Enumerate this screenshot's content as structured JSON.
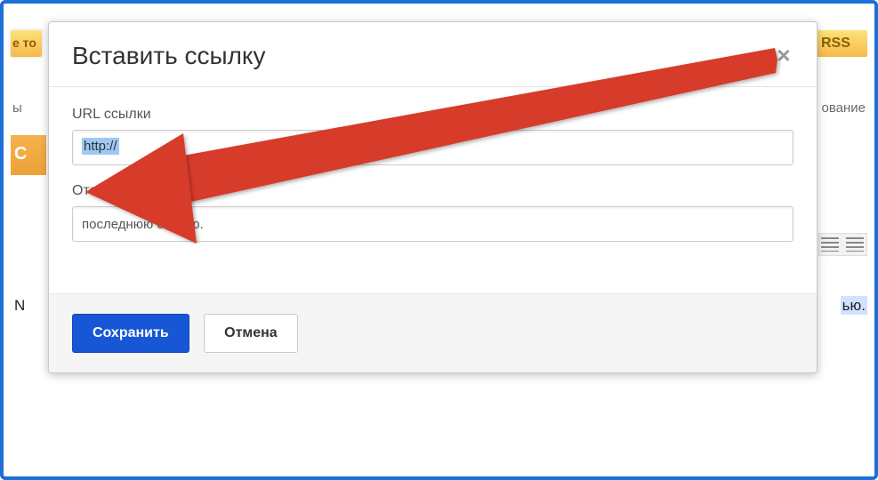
{
  "modal": {
    "title": "Вставить ссылку",
    "url_label": "URL ссылки",
    "url_value": "http://",
    "text_label": "Отображаемый текст",
    "text_value": "последнюю статью.",
    "save_label": "Сохранить",
    "cancel_label": "Отмена"
  },
  "bg": {
    "yellow_tab": "е то",
    "rss": "RSS",
    "tabs_left": "ы",
    "tabs_right": "ование",
    "orange": "С",
    "n_char": "N",
    "text_snip": "ью."
  },
  "colors": {
    "frame": "#1e6fd6",
    "primary_btn": "#1757d6",
    "arrow": "#d73a29"
  }
}
